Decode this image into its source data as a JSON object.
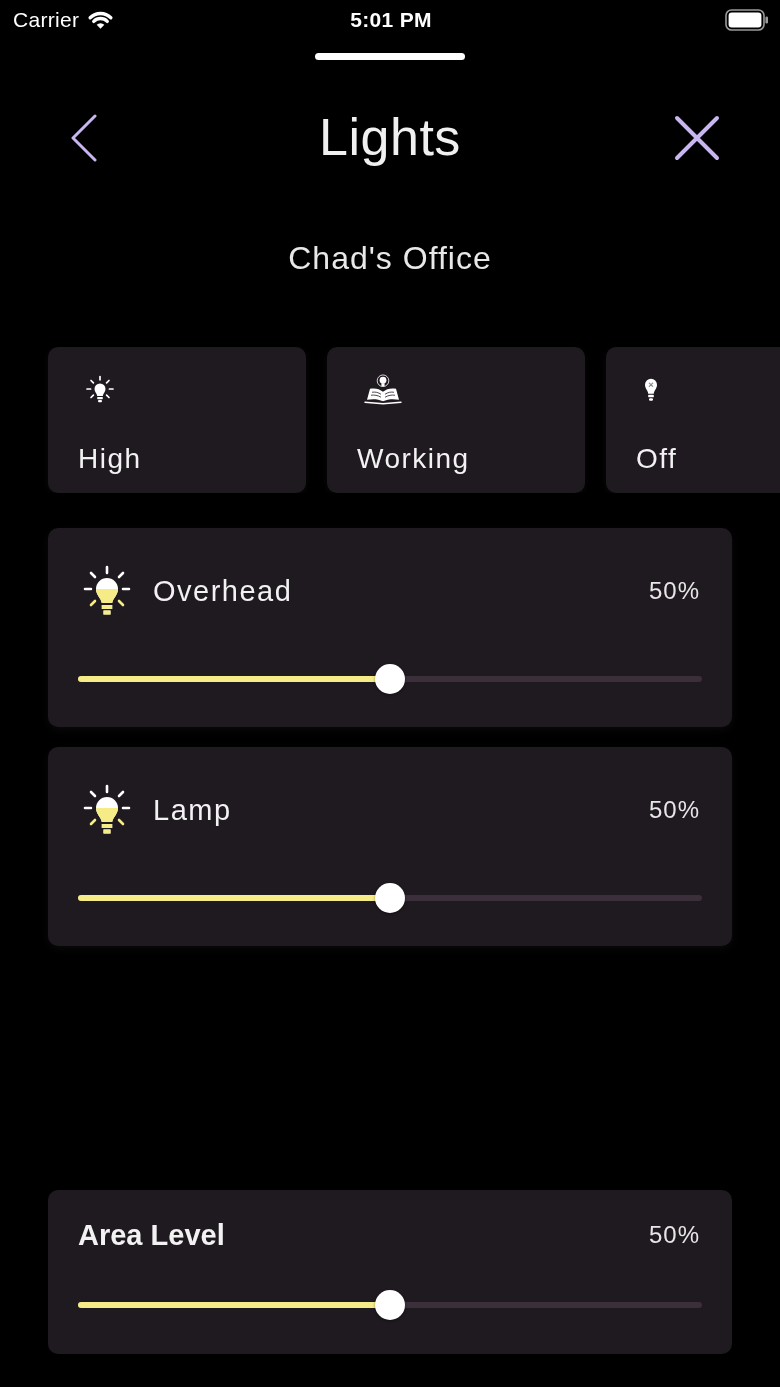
{
  "status_bar": {
    "carrier": "Carrier",
    "time": "5:01 PM"
  },
  "header": {
    "title": "Lights",
    "subtitle": "Chad's Office"
  },
  "scenes": [
    {
      "label": "High",
      "selected": false
    },
    {
      "label": "Working",
      "selected": false
    },
    {
      "label": "Off",
      "selected": false
    }
  ],
  "lights": [
    {
      "name": "Overhead",
      "level": 0.5,
      "reading": "50%"
    },
    {
      "name": "Lamp",
      "level": 0.5,
      "reading": "50%"
    }
  ],
  "area": {
    "title": "Area Level",
    "level": 0.5,
    "reading": "50%"
  }
}
